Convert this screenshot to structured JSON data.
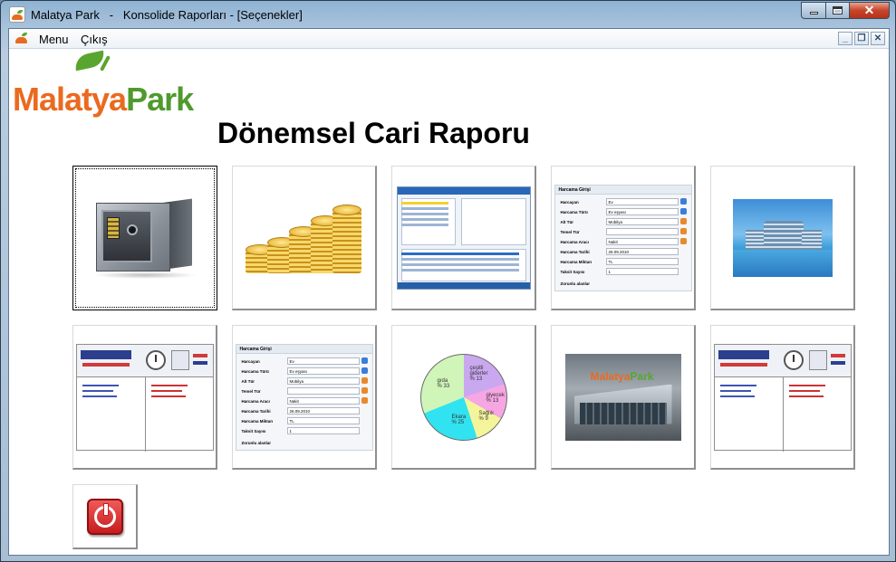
{
  "window": {
    "title": "Malatya Park   -   Konsolide Raporları - [Seçenekler]",
    "controls": {
      "minimize": "–",
      "maximize": "□",
      "close": "✕"
    }
  },
  "menubar": {
    "items": [
      {
        "label": "Menu"
      },
      {
        "label": "Çıkış"
      }
    ],
    "mdi_controls": {
      "minimize": "_",
      "restore": "❐",
      "close": "✕"
    }
  },
  "logo": {
    "part1": "Malatya",
    "part2": "Park"
  },
  "page": {
    "title": "Dönemsel Cari Raporu"
  },
  "expense_form": {
    "header": "Harcama Girişi",
    "fields": [
      {
        "label": "Harcayan",
        "value": "Ev"
      },
      {
        "label": "Harcama Türü",
        "value": "Ev eşyası"
      },
      {
        "label": "Alt Tür",
        "value": "Mobilya"
      },
      {
        "label": "Temel Tür",
        "value": ""
      },
      {
        "label": "Harcama Aracı",
        "value": "Nakit"
      },
      {
        "label": "Harcama Tarihi",
        "value": "26.09.2010"
      },
      {
        "label": "Harcama Miktarı",
        "value": "TL"
      },
      {
        "label": "Taksit Sayısı",
        "value": "1"
      }
    ],
    "footer": "Zorunlu alanlar"
  },
  "pie_chart": {
    "slices": [
      {
        "label": "gıda",
        "percent": "% 33"
      },
      {
        "label": "çeşitli giderler",
        "percent": "% 13"
      },
      {
        "label": "giyecek",
        "percent": "% 13"
      },
      {
        "label": "Sağlık",
        "percent": "% 9"
      },
      {
        "label": "Ekara",
        "percent": "% 25"
      }
    ]
  },
  "exit": {
    "icon": "power-icon"
  },
  "colors": {
    "accent_orange": "#ea6a20",
    "accent_green": "#4f9a2d",
    "close_red": "#c6452a"
  }
}
